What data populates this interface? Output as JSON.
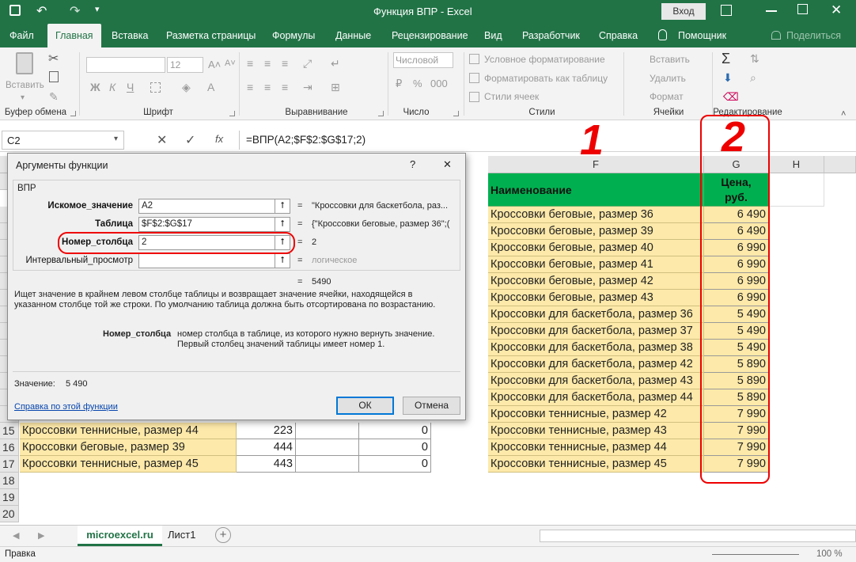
{
  "window": {
    "title": "Функция ВПР  -  Excel",
    "login_label": "Вход"
  },
  "tabs": [
    "Файл",
    "Главная",
    "Вставка",
    "Разметка страницы",
    "Формулы",
    "Данные",
    "Рецензирование",
    "Вид",
    "Разработчик",
    "Справка",
    "Помощник",
    "Поделиться"
  ],
  "ribbon": {
    "paste_label": "Вставить",
    "clipboard_label": "Буфер обмена",
    "font_label": "Шрифт",
    "font_size": "12",
    "align_label": "Выравнивание",
    "number_format": "Числовой",
    "number_label": "Число",
    "cond_format": "Условное форматирование",
    "format_table": "Форматировать как таблицу",
    "cell_styles": "Стили ячеек",
    "styles_label": "Стили",
    "insert": "Вставить",
    "delete": "Удалить",
    "format": "Формат",
    "cells_label": "Ячейки",
    "edit_label": "Редактирование"
  },
  "formula_bar": {
    "name_box": "C2",
    "formula": "=ВПР(A2;$F$2:$G$17;2)"
  },
  "columns": {
    "F": "F",
    "G": "G",
    "H": "H"
  },
  "table_right": {
    "header_name": "Наименование",
    "header_price_line1": "Цена,",
    "header_price_line2": "руб.",
    "rows": [
      {
        "name": "Кроссовки беговые, размер 36",
        "price": "6 490"
      },
      {
        "name": "Кроссовки беговые, размер 39",
        "price": "6 490"
      },
      {
        "name": "Кроссовки беговые, размер 40",
        "price": "6 990"
      },
      {
        "name": "Кроссовки беговые, размер 41",
        "price": "6 990"
      },
      {
        "name": "Кроссовки беговые, размер 42",
        "price": "6 990"
      },
      {
        "name": "Кроссовки беговые, размер 43",
        "price": "6 990"
      },
      {
        "name": "Кроссовки для баскетбола, размер 36",
        "price": "5 490"
      },
      {
        "name": "Кроссовки для баскетбола, размер 37",
        "price": "5 490"
      },
      {
        "name": "Кроссовки для баскетбола, размер 38",
        "price": "5 490"
      },
      {
        "name": "Кроссовки для баскетбола, размер 42",
        "price": "5 890"
      },
      {
        "name": "Кроссовки для баскетбола, размер 43",
        "price": "5 890"
      },
      {
        "name": "Кроссовки для баскетбола, размер 44",
        "price": "5 890"
      },
      {
        "name": "Кроссовки теннисные, размер 42",
        "price": "7 990"
      },
      {
        "name": "Кроссовки теннисные, размер 43",
        "price": "7 990"
      },
      {
        "name": "Кроссовки теннисные, размер 44",
        "price": "7 990"
      },
      {
        "name": "Кроссовки теннисные, размер 45",
        "price": "7 990"
      }
    ]
  },
  "table_left": [
    {
      "row": "15",
      "name": "Кроссовки теннисные, размер 44",
      "qty": "223",
      "total": "0"
    },
    {
      "row": "16",
      "name": "Кроссовки беговые, размер 39",
      "qty": "444",
      "total": "0"
    },
    {
      "row": "17",
      "name": "Кроссовки теннисные, размер 45",
      "qty": "443",
      "total": "0"
    }
  ],
  "empty_rows": [
    "18",
    "19",
    "20"
  ],
  "dialog": {
    "title": "Аргументы функции",
    "help_q": "?",
    "close": "✕",
    "func_name": "ВПР",
    "args": [
      {
        "label": "Искомое_значение",
        "value": "A2",
        "result": "\"Кроссовки для баскетбола, раз..."
      },
      {
        "label": "Таблица",
        "value": "$F$2:$G$17",
        "result": "{\"Кроссовки беговые, размер 36\";("
      },
      {
        "label": "Номер_столбца",
        "value": "2",
        "result": "2"
      },
      {
        "label": "Интервальный_просмотр",
        "value": "",
        "result": "логическое"
      }
    ],
    "result_value": "5490",
    "description": "Ищет значение в крайнем левом столбце таблицы и возвращает значение ячейки, находящейся в указанном столбце той же строки. По умолчанию таблица должна быть отсортирована по возрастанию.",
    "arg_name": "Номер_столбца",
    "arg_desc": "номер столбца в таблице, из которого нужно вернуть значение. Первый столбец значений таблицы имеет номер 1.",
    "value_label": "Значение:",
    "value": "5 490",
    "help_link": "Справка по этой функции",
    "ok": "ОК",
    "cancel": "Отмена"
  },
  "sheets": [
    "microexcel.ru",
    "Лист1"
  ],
  "status": {
    "mode": "Правка",
    "zoom": "100 %"
  },
  "annotations": {
    "one": "1",
    "two": "2"
  },
  "colors": {
    "excel_green": "#217346",
    "header_green": "#00b050",
    "row_yellow": "#fde9a9",
    "mark_red": "#e00000"
  }
}
